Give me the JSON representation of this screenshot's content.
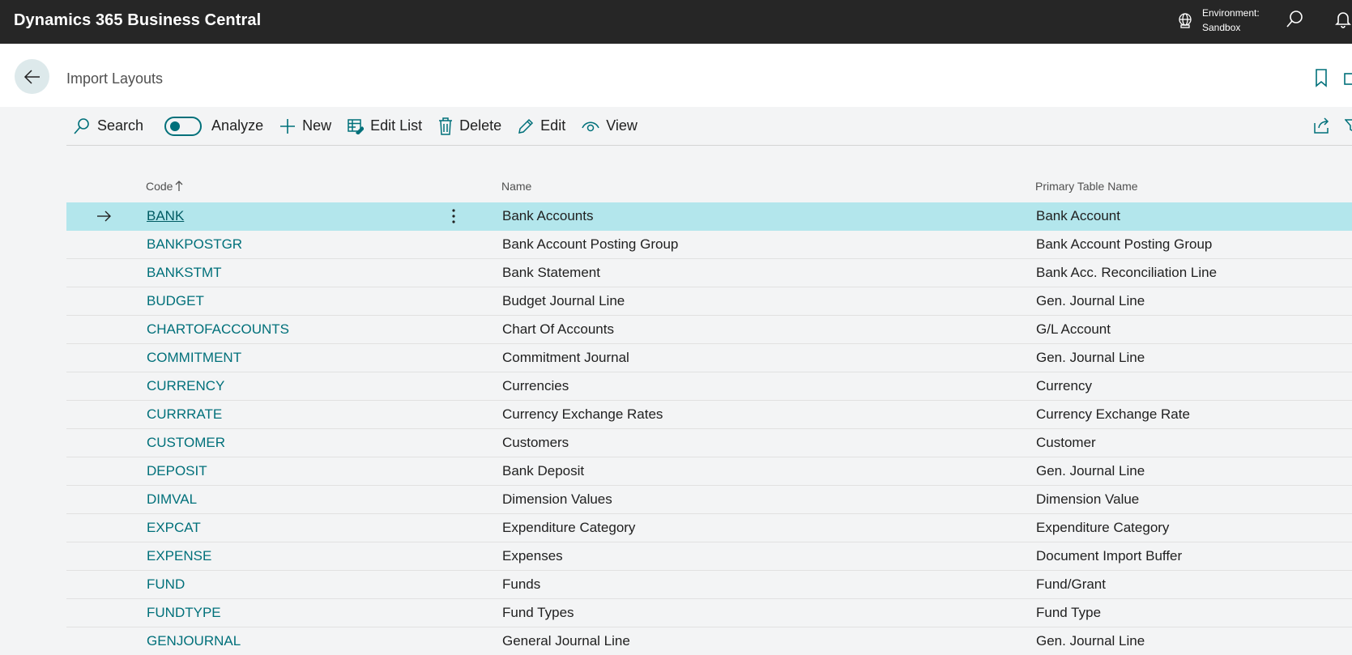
{
  "app": {
    "title": "Dynamics 365 Business Central",
    "environment_label": "Environment:",
    "environment_value": "Sandbox"
  },
  "page": {
    "title": "Import Layouts"
  },
  "actions": {
    "search": "Search",
    "analyze": "Analyze",
    "new": "New",
    "edit_list": "Edit List",
    "delete": "Delete",
    "edit": "Edit",
    "view": "View"
  },
  "table": {
    "headers": {
      "code": "Code",
      "name": "Name",
      "primary_table_name": "Primary Table Name"
    },
    "rows": [
      {
        "code": "BANK",
        "name": "Bank Accounts",
        "primary": "Bank Account"
      },
      {
        "code": "BANKPOSTGR",
        "name": "Bank Account Posting Group",
        "primary": "Bank Account Posting Group"
      },
      {
        "code": "BANKSTMT",
        "name": "Bank Statement",
        "primary": "Bank Acc. Reconciliation Line"
      },
      {
        "code": "BUDGET",
        "name": "Budget Journal Line",
        "primary": "Gen. Journal Line"
      },
      {
        "code": "CHARTOFACCOUNTS",
        "name": "Chart Of Accounts",
        "primary": "G/L Account"
      },
      {
        "code": "COMMITMENT",
        "name": "Commitment Journal",
        "primary": "Gen. Journal Line"
      },
      {
        "code": "CURRENCY",
        "name": "Currencies",
        "primary": "Currency"
      },
      {
        "code": "CURRRATE",
        "name": "Currency Exchange Rates",
        "primary": "Currency Exchange Rate"
      },
      {
        "code": "CUSTOMER",
        "name": "Customers",
        "primary": "Customer"
      },
      {
        "code": "DEPOSIT",
        "name": "Bank Deposit",
        "primary": "Gen. Journal Line"
      },
      {
        "code": "DIMVAL",
        "name": "Dimension Values",
        "primary": "Dimension Value"
      },
      {
        "code": "EXPCAT",
        "name": "Expenditure Category",
        "primary": "Expenditure Category"
      },
      {
        "code": "EXPENSE",
        "name": "Expenses",
        "primary": "Document Import Buffer"
      },
      {
        "code": "FUND",
        "name": "Funds",
        "primary": "Fund/Grant"
      },
      {
        "code": "FUNDTYPE",
        "name": "Fund Types",
        "primary": "Fund Type"
      },
      {
        "code": "GENJOURNAL",
        "name": "General Journal Line",
        "primary": "Gen. Journal Line"
      }
    ]
  },
  "colors": {
    "topbar": "#262626",
    "accent": "#00707a",
    "selected_row": "#b3e6ec"
  }
}
